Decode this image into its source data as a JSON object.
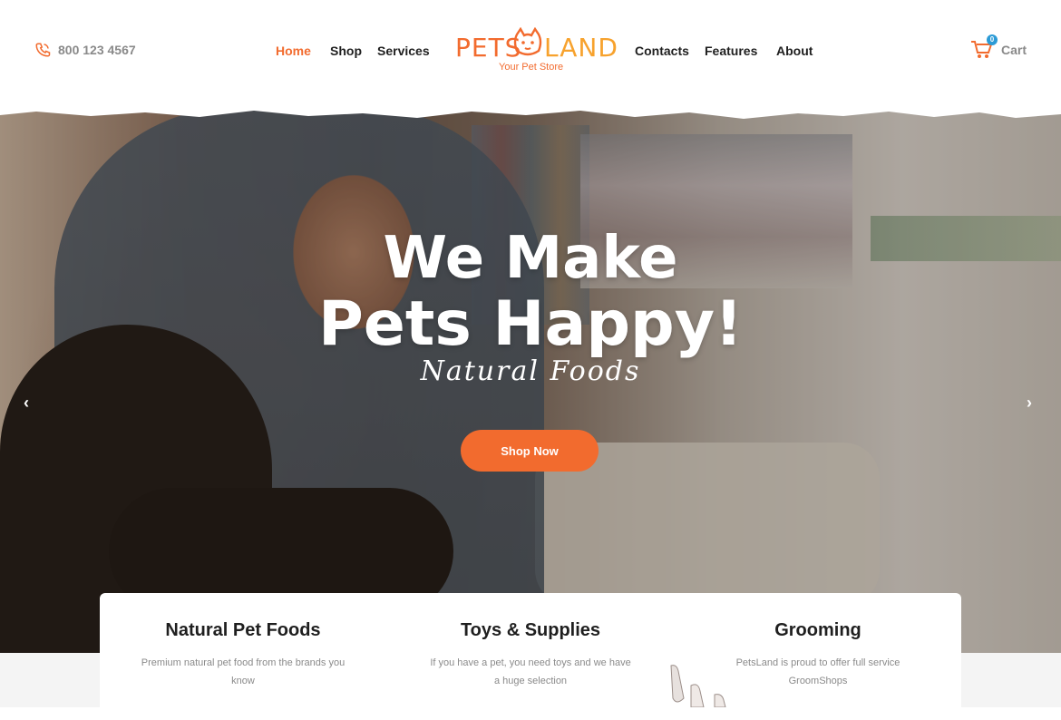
{
  "header": {
    "phone": "800 123 4567",
    "nav_left": [
      "Home",
      "Shop",
      "Services"
    ],
    "nav_right": [
      "Contacts",
      "Features",
      "About"
    ],
    "logo": {
      "left": "PETS",
      "right": "LAND",
      "tagline": "Your Pet Store"
    },
    "cart_label": "Cart",
    "cart_count": "0"
  },
  "hero": {
    "title_line1": "We Make",
    "title_line2": "Pets Happy!",
    "script": "Natural Foods",
    "cta": "Shop Now"
  },
  "features": [
    {
      "title": "Natural Pet Foods",
      "text": "Premium natural pet food from the brands you know"
    },
    {
      "title": "Toys & Supplies",
      "text": "If you have a pet, you need toys and we have a huge selection"
    },
    {
      "title": "Grooming",
      "text": "PetsLand is proud to offer full service GroomShops"
    }
  ],
  "colors": {
    "accent": "#f26b2e",
    "logo_secondary": "#f7a22d",
    "badge": "#2c9bd6",
    "text_dark": "#1f1f1f",
    "text_muted": "#8a8a8a"
  }
}
